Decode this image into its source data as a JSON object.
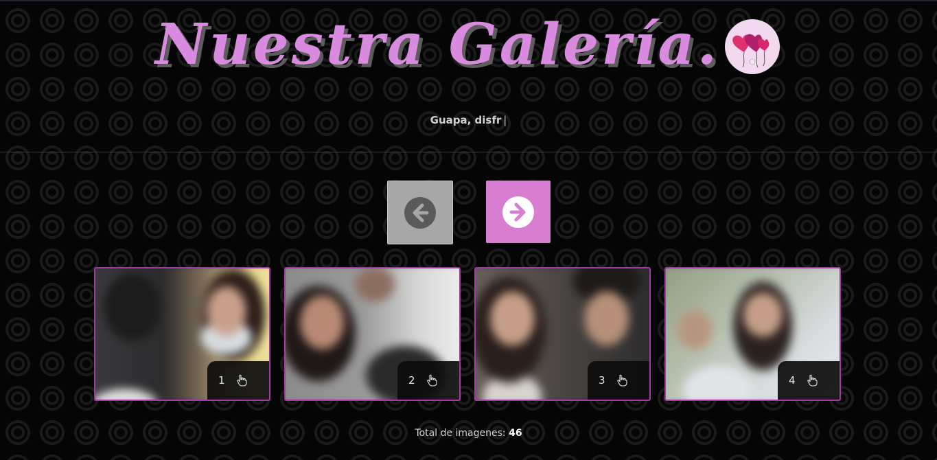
{
  "header": {
    "title": "Nuestra Galería.",
    "subtitle_typed": "Guapa, disfr",
    "cursor": "|",
    "badge_icon": "heart-balloons-icon"
  },
  "navigation": {
    "prev_icon": "arrow-left-circle-icon",
    "next_icon": "arrow-right-circle-icon"
  },
  "gallery": {
    "cards": [
      {
        "number": "1",
        "icon": "hand-pointer-icon"
      },
      {
        "number": "2",
        "icon": "hand-pointer-icon"
      },
      {
        "number": "3",
        "icon": "hand-pointer-icon"
      },
      {
        "number": "4",
        "icon": "hand-pointer-icon"
      }
    ]
  },
  "footer": {
    "total_label": "Total de imagenes:",
    "total_value": "46"
  },
  "colors": {
    "accent": "#d77ed1",
    "title": "#d98be0",
    "card_border": "#a33aa6",
    "background": "#050505"
  }
}
